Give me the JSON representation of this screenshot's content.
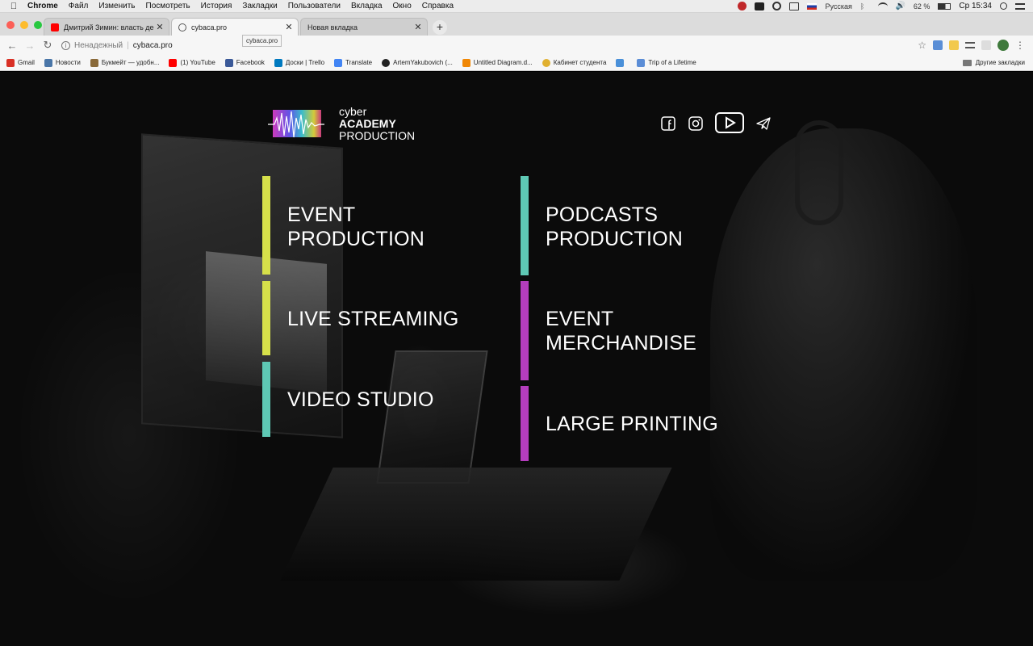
{
  "menubar": {
    "app": "Chrome",
    "items": [
      "Файл",
      "Изменить",
      "Посмотреть",
      "История",
      "Закладки",
      "Пользователи",
      "Вкладка",
      "Окно",
      "Справка"
    ],
    "keyboard": "Русская",
    "battery": "62 %",
    "clock": "Ср 15:34"
  },
  "tabs": [
    {
      "title": "Дмитрий Зимин: власть деспот",
      "active": false
    },
    {
      "title": "cybaca.pro",
      "active": true
    },
    {
      "title": "Новая вкладка",
      "active": false
    }
  ],
  "tooltip": "cybaca.pro",
  "omnibox": {
    "security": "Ненадежный",
    "url": "cybaca.pro"
  },
  "bookmarks": [
    {
      "label": "Gmail",
      "color": "#d93025"
    },
    {
      "label": "Новости",
      "color": "#4a76a8"
    },
    {
      "label": "Букмейт — удобн...",
      "color": "#8a6a3a"
    },
    {
      "label": "(1) YouTube",
      "color": "#ff0000"
    },
    {
      "label": "Facebook",
      "color": "#3b5998"
    },
    {
      "label": "Доски | Trello",
      "color": "#0079bf"
    },
    {
      "label": "Translate",
      "color": "#4285f4"
    },
    {
      "label": "ArtemYakubovich (...",
      "color": "#222222"
    },
    {
      "label": "Untitled Diagram.d...",
      "color": "#f08705"
    },
    {
      "label": "Кабинет студента",
      "color": "#e0b030"
    },
    {
      "label": "",
      "color": "#4a90d9"
    },
    {
      "label": "Trip of a Lifetime",
      "color": "#5b8dd6"
    }
  ],
  "other_bookmarks": "Другие закладки",
  "site": {
    "logo": {
      "line1": "cyber",
      "line2": "ACADEMY",
      "line3": "PRODUCTION"
    },
    "social_icons": [
      "facebook-icon",
      "instagram-icon",
      "youtube-icon",
      "telegram-icon"
    ],
    "services": [
      {
        "label": "EVENT\nPRODUCTION",
        "color": "#d6e04a"
      },
      {
        "label": "LIVE STREAMING",
        "color": "#d6e04a"
      },
      {
        "label": "VIDEO STUDIO",
        "color": "#5ec8b4"
      },
      {
        "label": "PODCASTS\nPRODUCTION",
        "color": "#5ec8b4"
      },
      {
        "label": "EVENT\nMERCHANDISE",
        "color": "#b43dbd"
      },
      {
        "label": "LARGE PRINTING",
        "color": "#b43dbd"
      }
    ]
  }
}
